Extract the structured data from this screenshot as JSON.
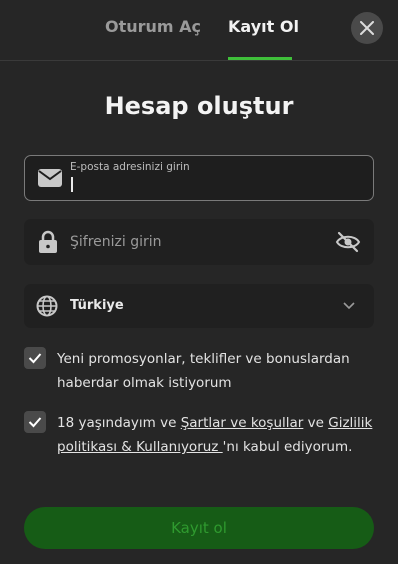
{
  "tabs": {
    "login_label": "Oturum Aç",
    "register_label": "Kayıt Ol"
  },
  "title": "Hesap oluştur",
  "email": {
    "label": "E-posta adresinizi girin",
    "value": ""
  },
  "password": {
    "placeholder": "Şifrenizi girin"
  },
  "country": {
    "value": "Türkiye"
  },
  "promo": {
    "text": "Yeni promosyonlar, teklifler ve bonuslardan haberdar olmak istiyorum",
    "checked": true
  },
  "terms": {
    "prefix": "18 yaşındayım ve ",
    "terms_link": "Şartlar ve koşullar",
    "mid": " ve ",
    "privacy_link": "Gizlilik politikası & Kullanıyoruz ",
    "suffix": "'nı kabul ediyorum.",
    "checked": true
  },
  "submit_label": "Kayıt ol",
  "colors": {
    "accent": "#3fbf3a",
    "background": "#262626",
    "submit_bg": "#165c16"
  },
  "icons": [
    "close-icon",
    "envelope-icon",
    "lock-icon",
    "eye-off-icon",
    "globe-icon",
    "chevron-down-icon",
    "check-icon"
  ]
}
